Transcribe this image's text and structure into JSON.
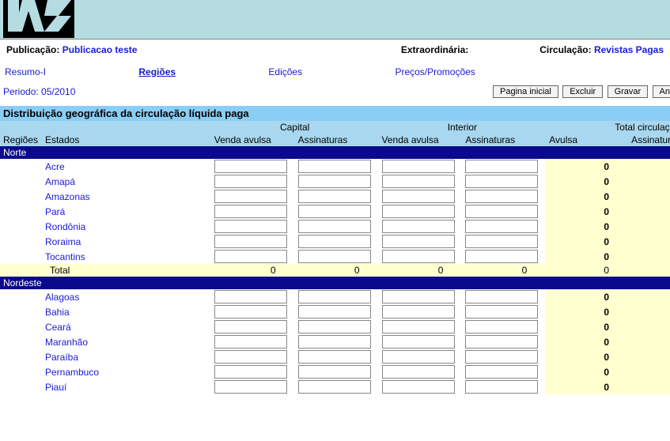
{
  "header": {
    "publicacao_label": "Publicação:",
    "publicacao_value": "Publicacao teste",
    "extraordinaria_label": "Extraordinária:",
    "circulacao_label": "Circulação:",
    "circulacao_value": "Revistas Pagas"
  },
  "tabs": {
    "resumo": "Resumo-I",
    "regioes": "Regiões",
    "edicoes": "Edições",
    "precos": "Preços/Promoções"
  },
  "period": {
    "text": "Periodo: 05/2010"
  },
  "buttons": {
    "home": "Pagina inicial",
    "excluir": "Excluir",
    "gravar": "Gravar",
    "an": "An"
  },
  "table": {
    "title": "Distribuição geográfica da circulação líquida paga",
    "group_capital": "Capital",
    "group_interior": "Interior",
    "group_total": "Total circulação",
    "col_regioes": "Regiões",
    "col_estados": "Estados",
    "col_venda_avulsa": "Venda avulsa",
    "col_assinaturas": "Assinaturas",
    "col_avulsa": "Avulsa",
    "col_assinatura": "Assinatura",
    "zero": "0",
    "total_label": "Total",
    "regions": [
      {
        "name": "Norte",
        "states": [
          "Acre",
          "Amapá",
          "Amazonas",
          "Pará",
          "Rondônia",
          "Roraima",
          "Tocantins"
        ]
      },
      {
        "name": "Nordeste",
        "states": [
          "Alagoas",
          "Bahia",
          "Ceará",
          "Maranhão",
          "Paraíba",
          "Pernambuco",
          "Piauí"
        ]
      }
    ]
  }
}
